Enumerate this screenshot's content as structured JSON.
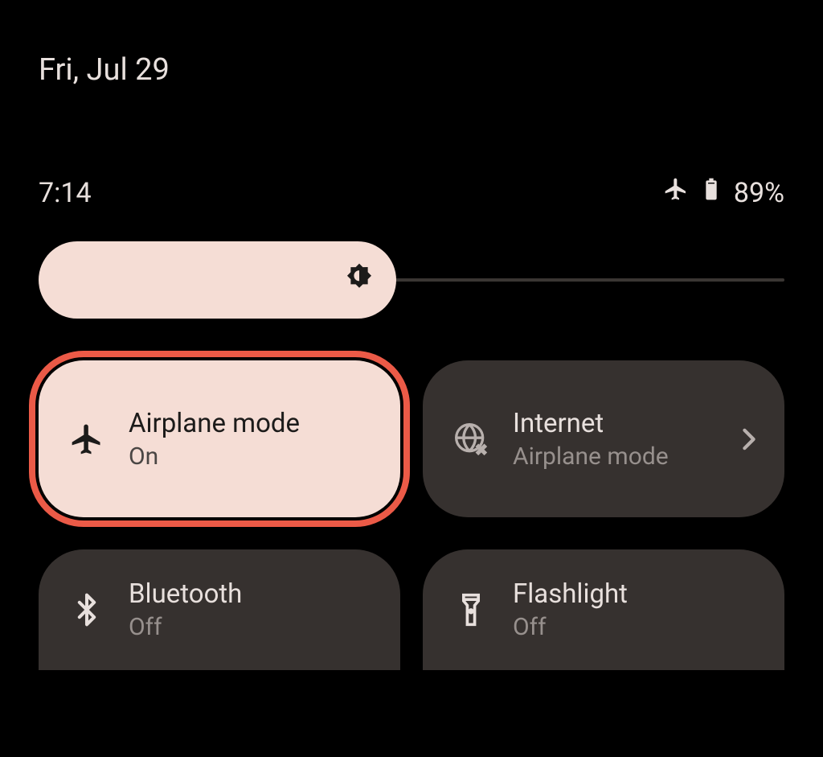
{
  "header": {
    "date": "Fri, Jul 29"
  },
  "status": {
    "time": "7:14",
    "battery_percent": "89%"
  },
  "tiles": [
    {
      "title": "Airplane mode",
      "subtitle": "On",
      "state": "on",
      "highlighted": true
    },
    {
      "title": "Internet",
      "subtitle": "Airplane mode",
      "state": "off",
      "chevron": true
    },
    {
      "title": "Bluetooth",
      "subtitle": "Off",
      "state": "off"
    },
    {
      "title": "Flashlight",
      "subtitle": "Off",
      "state": "off"
    }
  ]
}
